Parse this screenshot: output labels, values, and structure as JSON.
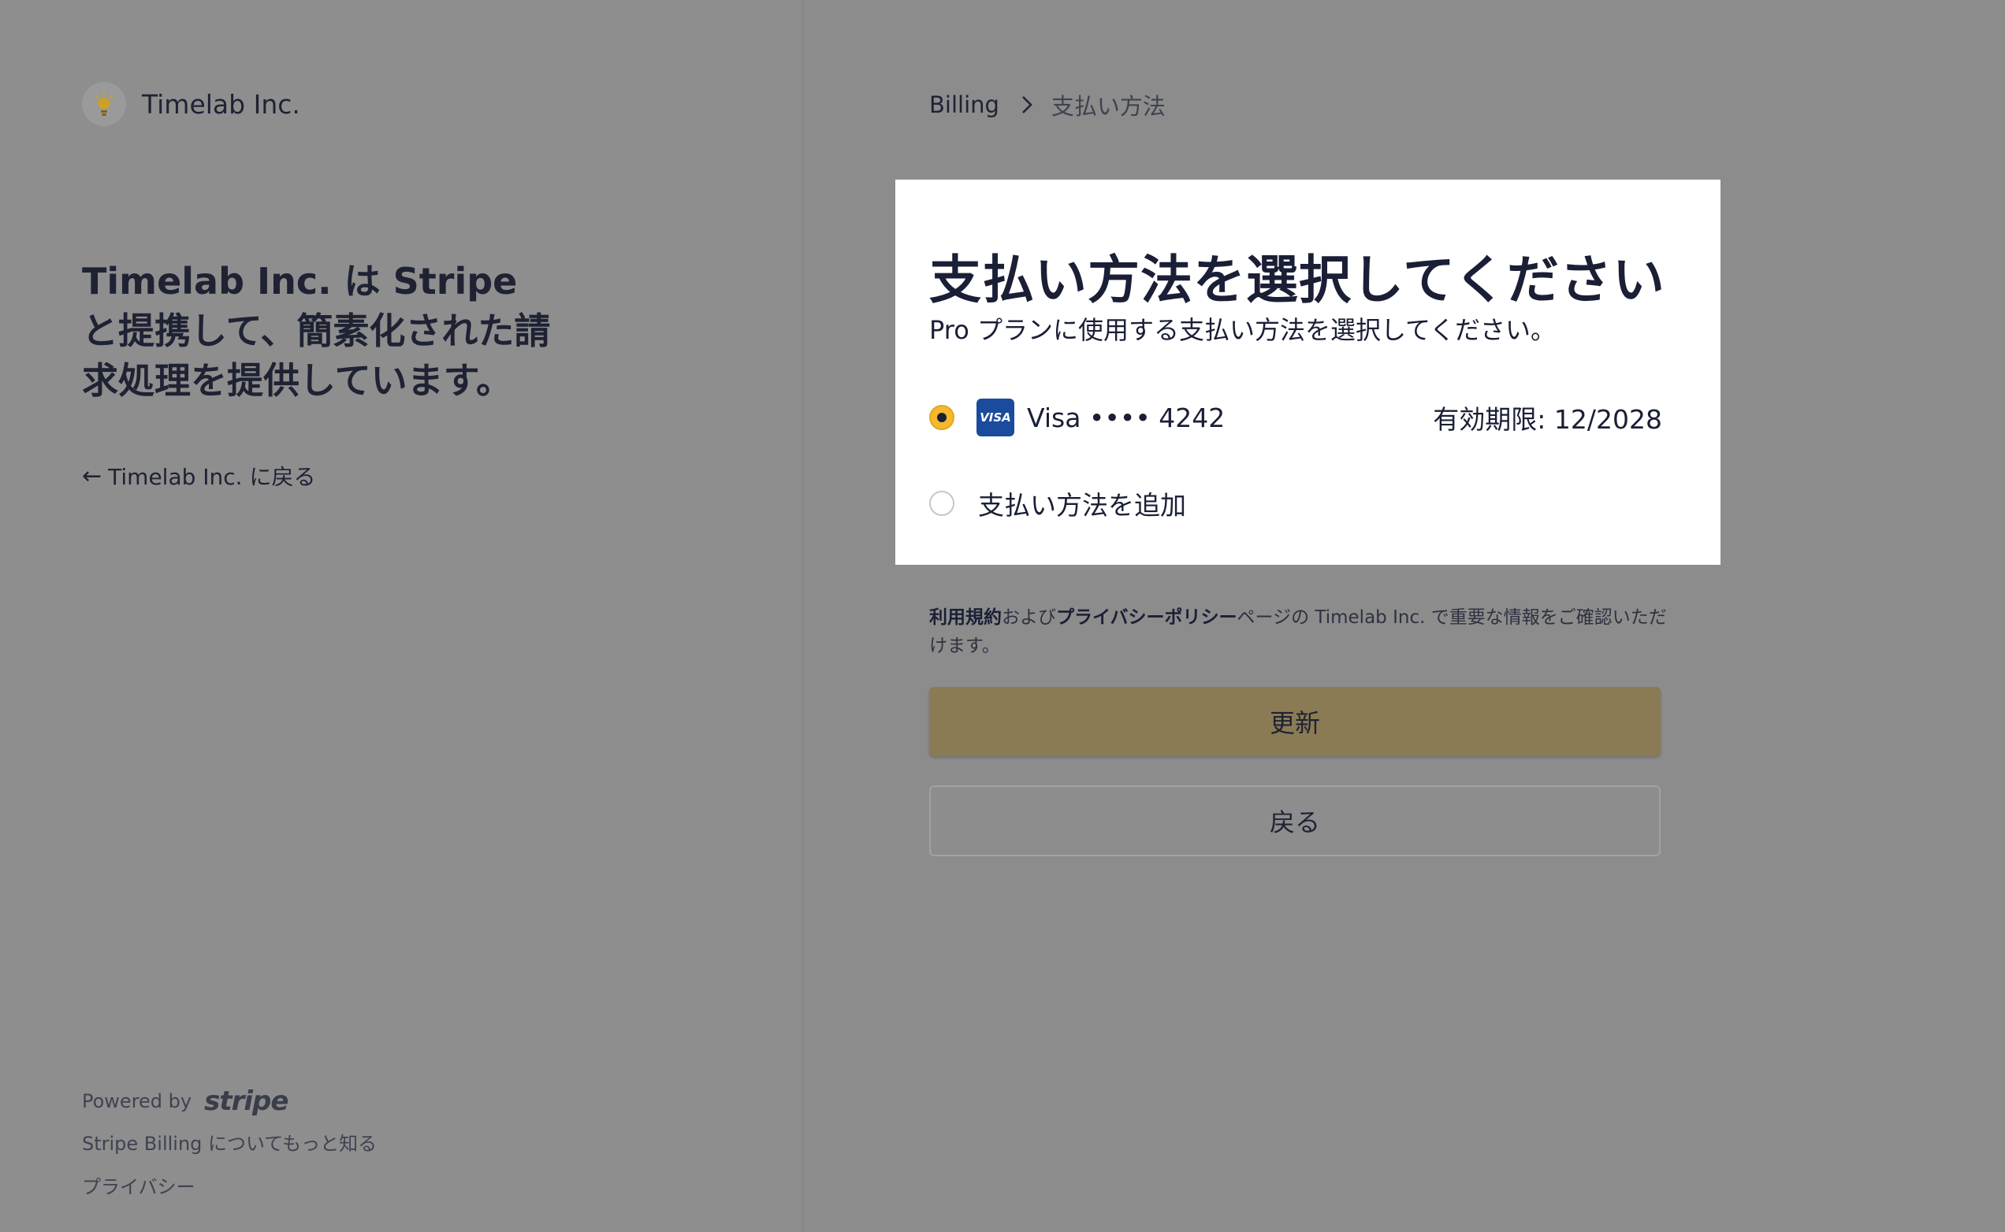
{
  "brand": {
    "name": "Timelab Inc."
  },
  "left": {
    "tagline": "Timelab Inc. は Stripe と提携して、簡素化された請求処理を提供しています。",
    "back_link": "Timelab Inc. に戻る"
  },
  "footer": {
    "powered_by": "Powered by",
    "stripe_logo": "stripe",
    "learn_more": "Stripe Billing についてもっと知る",
    "privacy": "プライバシー"
  },
  "breadcrumb": {
    "parent": "Billing",
    "current": "支払い方法"
  },
  "card": {
    "title": "支払い方法を選択してください",
    "subtitle": "Pro プランに使用する支払い方法を選択してください。",
    "options": [
      {
        "brand_badge": "VISA",
        "label": "Visa •••• 4242",
        "expiry": "有効期限: 12/2028",
        "selected": true
      },
      {
        "label": "支払い方法を追加",
        "selected": false
      }
    ]
  },
  "terms": {
    "terms_link": "利用規約",
    "and": "および",
    "privacy_link": "プライバシーポリシー",
    "rest": "ページの Timelab Inc. で重要な情報をご確認いただけます。"
  },
  "buttons": {
    "update": "更新",
    "back": "戻る"
  },
  "colors": {
    "accent": "#f5b82e",
    "primary_button": "#8a7b55",
    "visa_blue": "#1a4b9c"
  },
  "icons": {
    "brand_logo": "lightbulb-icon",
    "back_arrow": "arrow-left-icon",
    "breadcrumb_separator": "chevron-right-icon"
  }
}
